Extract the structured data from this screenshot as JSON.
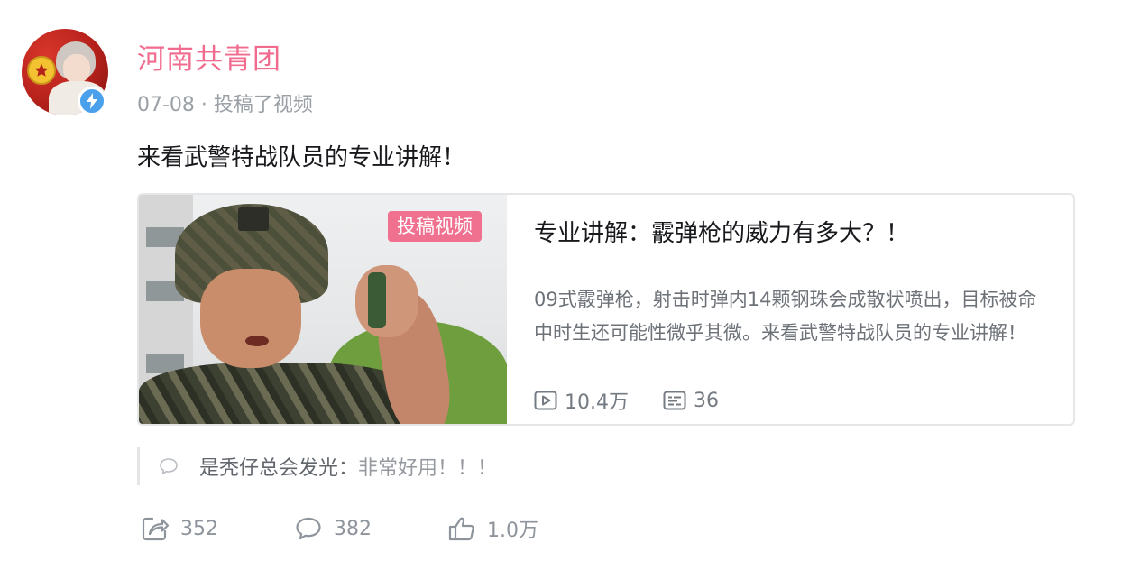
{
  "author": {
    "name": "河南共青团",
    "date": "07-08",
    "meta_separator": " · ",
    "action_text": "投稿了视频"
  },
  "post": {
    "text": "来看武警特战队员的专业讲解！"
  },
  "card": {
    "badge": "投稿视频",
    "title": "专业讲解：霰弹枪的威力有多大？！",
    "description": "09式霰弹枪，射击时弹内14颗钢珠会成散状喷出，目标被命中时生还可能性微乎其微。来看武警特战队员的专业讲解！",
    "views": "10.4万",
    "danmaku": "36"
  },
  "comment": {
    "user": "是秃仔总会发光",
    "separator": "：",
    "text": "非常好用！！！"
  },
  "actions": {
    "share": "352",
    "comments": "382",
    "likes": "1.0万"
  },
  "colors": {
    "author_pink": "#f06b8e",
    "badge_pink": "#f0708f",
    "verify_blue": "#4aa0ea"
  },
  "icons": [
    "verified-lightning-icon",
    "play-icon",
    "danmaku-icon",
    "comment-bubble-icon",
    "share-icon",
    "reply-icon",
    "thumbs-up-icon"
  ]
}
